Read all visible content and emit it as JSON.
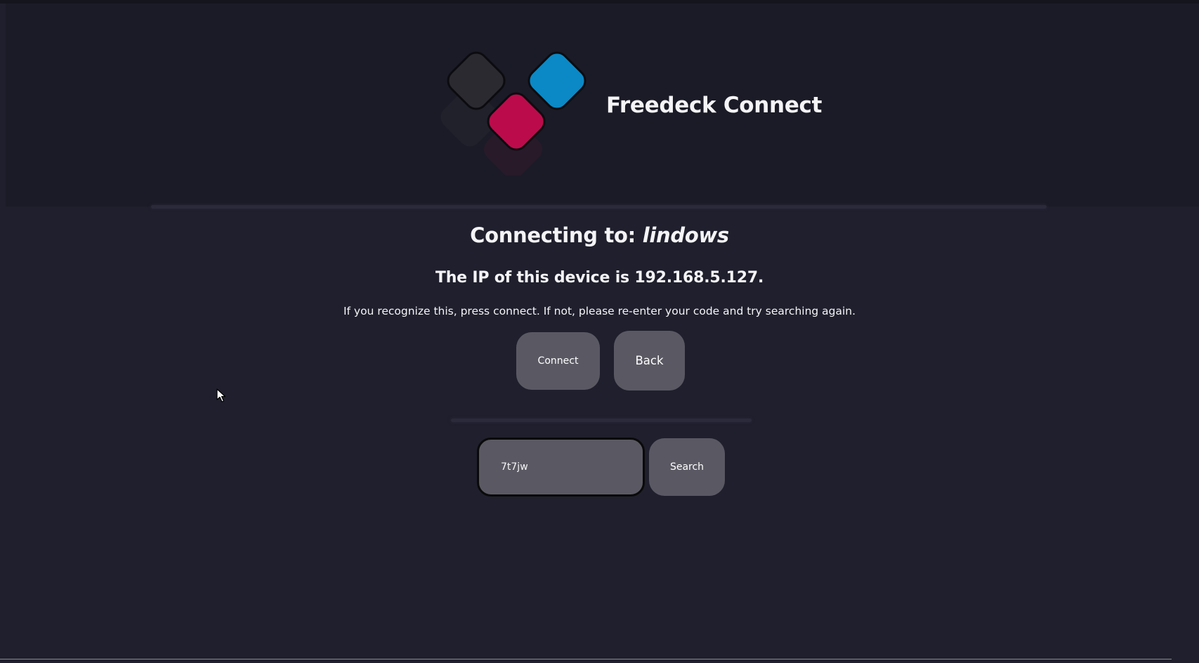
{
  "app": {
    "title": "Freedeck Connect",
    "logo_colors": {
      "dark": "#2a2a30",
      "blue": "#0a89c6",
      "magenta": "#bc0b4b"
    }
  },
  "connect": {
    "heading_prefix": "Connecting to: ",
    "host_name": "lindows",
    "ip_line": "The IP of this device is 192.168.5.127.",
    "hint": "If you recognize this, press connect. If not, please re-enter your code and try searching again.",
    "connect_label": "Connect",
    "back_label": "Back"
  },
  "search": {
    "code_value": "7t7jw",
    "search_label": "Search"
  }
}
